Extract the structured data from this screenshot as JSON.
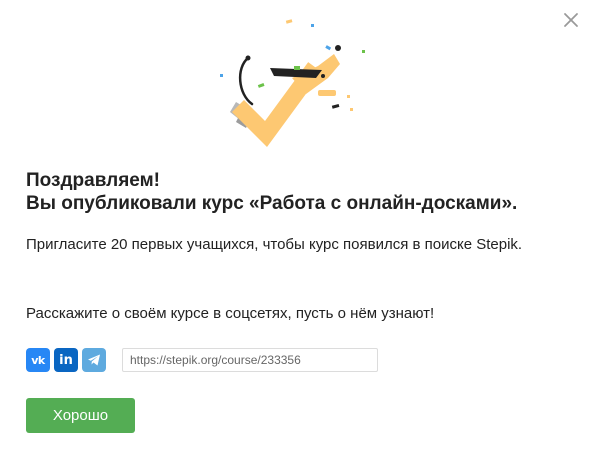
{
  "dialog": {
    "close_icon": "close-icon",
    "illustration_icon": "celebration-checkmark-icon",
    "accent_colors": {
      "check": "#fdc872",
      "button": "#54ad54",
      "vk": "#2787f5",
      "linkedin": "#0a66c2",
      "telegram": "#5eaadf"
    },
    "title_line1": "Поздравляем!",
    "title_line2": "Вы опубликовали курс «Работа с онлайн-досками».",
    "invite_text": "Пригласите 20 первых учащихся, чтобы курс появился в поиске Stepik.",
    "share_text": "Расскажите о своём курсе в соцсетях, пусть о нём узнают!",
    "social": {
      "vk_label": "vk",
      "linkedin_label": "in",
      "telegram_icon": "telegram-icon"
    },
    "course_url": "https://stepik.org/course/233356",
    "ok_label": "Хорошо"
  }
}
